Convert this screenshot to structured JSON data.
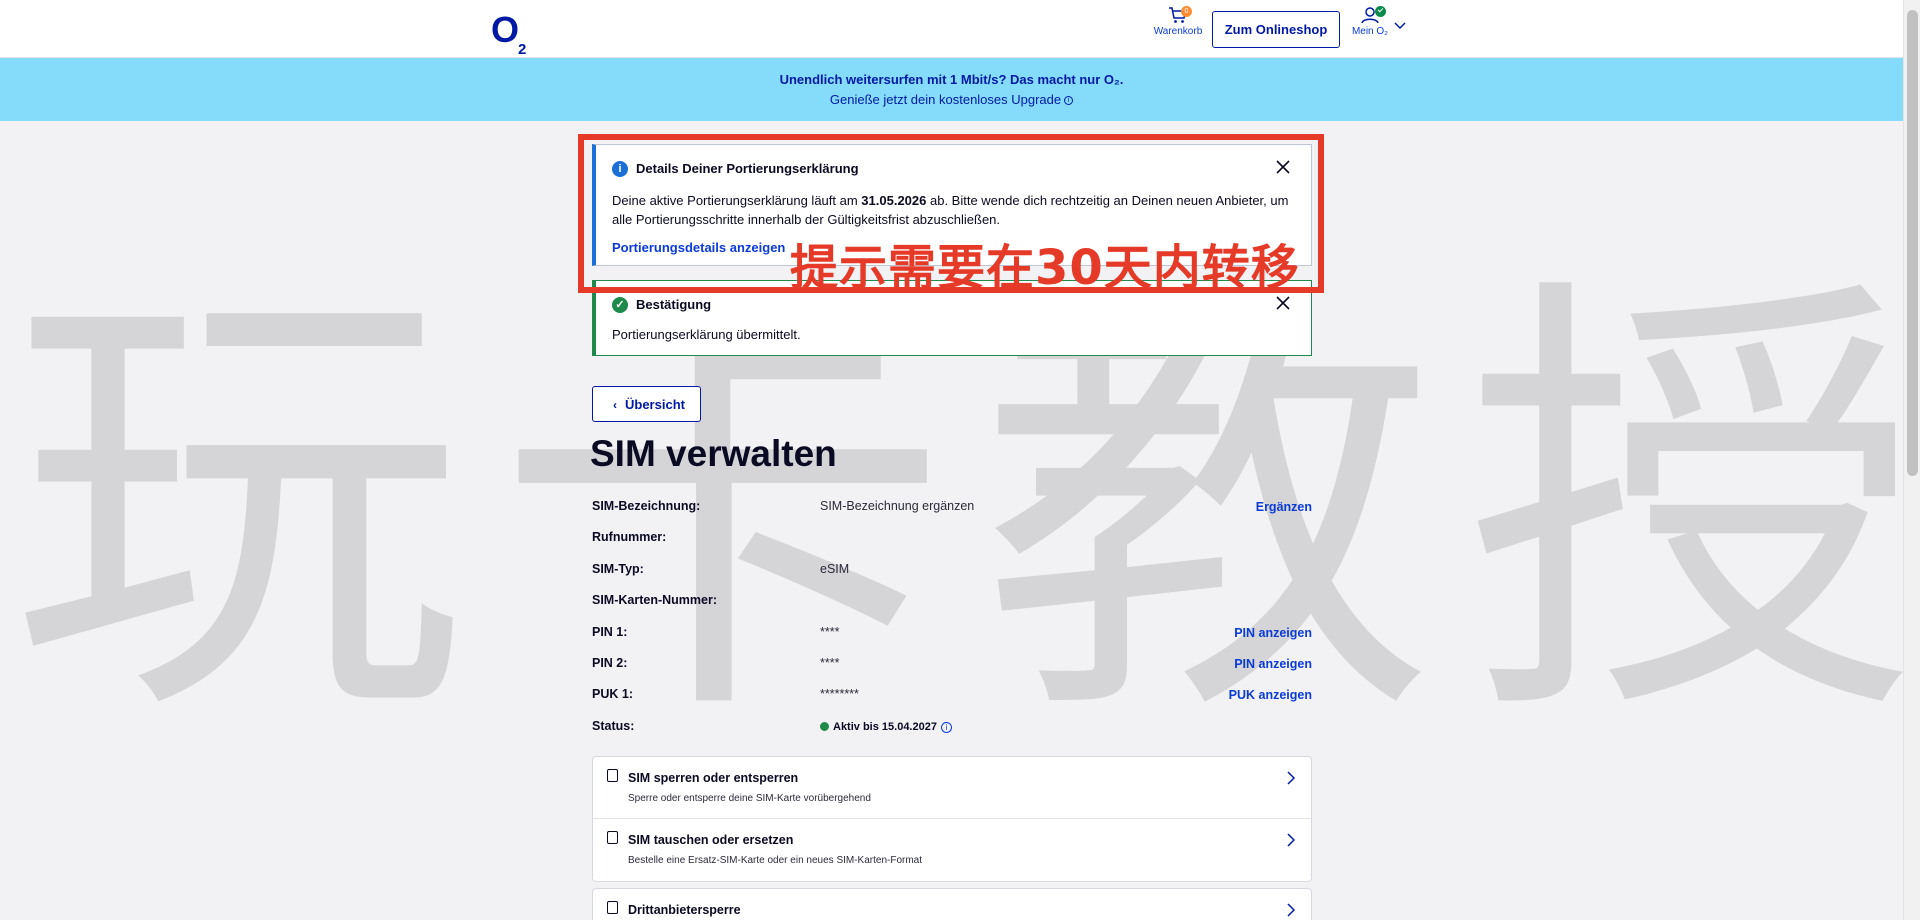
{
  "header": {
    "logo": "O",
    "logo_sub": "2",
    "cart_label": "Warenkorb",
    "cart_count": "0",
    "shop_button": "Zum Onlineshop",
    "account_label": "Mein O₂"
  },
  "promo": {
    "line1": "Unendlich weitersurfen mit 1 Mbit/s? Das macht nur O₂.",
    "line2": "Genieße jetzt dein kostenloses Upgrade"
  },
  "watermark": "玩卡教授",
  "annotation": {
    "text": "提示需要在30天内转移",
    "color": "#e63a28"
  },
  "alerts": {
    "porting": {
      "title": "Details Deiner Portierungserklärung",
      "body_pre": "Deine aktive Portierungserklärung läuft am ",
      "date": "31.05.2026",
      "body_post": " ab. Bitte wende dich rechtzeitig an Deinen neuen Anbieter, um alle Portierungsschritte innerhalb der Gültigkeitsfrist abzuschließen.",
      "link": "Portierungsdetails anzeigen"
    },
    "confirm": {
      "title": "Bestätigung",
      "body": "Portierungserklärung übermittelt."
    }
  },
  "nav": {
    "back_label": "Übersicht"
  },
  "page": {
    "title": "SIM verwalten"
  },
  "details": [
    {
      "label": "SIM-Bezeichnung:",
      "value": "SIM-Bezeichnung ergänzen",
      "action": "Ergänzen"
    },
    {
      "label": "Rufnummer:",
      "value": "",
      "action": ""
    },
    {
      "label": "SIM-Typ:",
      "value": "eSIM",
      "action": ""
    },
    {
      "label": "SIM-Karten-Nummer:",
      "value": "",
      "action": ""
    },
    {
      "label": "PIN 1:",
      "value": "****",
      "action": "PIN anzeigen"
    },
    {
      "label": "PIN 2:",
      "value": "****",
      "action": "PIN anzeigen"
    },
    {
      "label": "PUK 1:",
      "value": "********",
      "action": "PUK anzeigen"
    },
    {
      "label": "Status:",
      "value": "Aktiv bis 15.04.2027",
      "action": ""
    }
  ],
  "cards": [
    {
      "title": "SIM sperren oder entsperren",
      "subtitle": "Sperre oder entsperre deine SIM-Karte vorübergehend"
    },
    {
      "title": "SIM tauschen oder ersetzen",
      "subtitle": "Bestelle eine Ersatz-SIM-Karte oder ein neues SIM-Karten-Format"
    }
  ],
  "card_partial": {
    "title": "Drittanbietersperre"
  },
  "colors": {
    "brand": "#0019a5",
    "link": "#0a3bd9",
    "promo_bg": "#85dbfa",
    "info": "#1c6fd6",
    "success": "#1f8a4c"
  }
}
